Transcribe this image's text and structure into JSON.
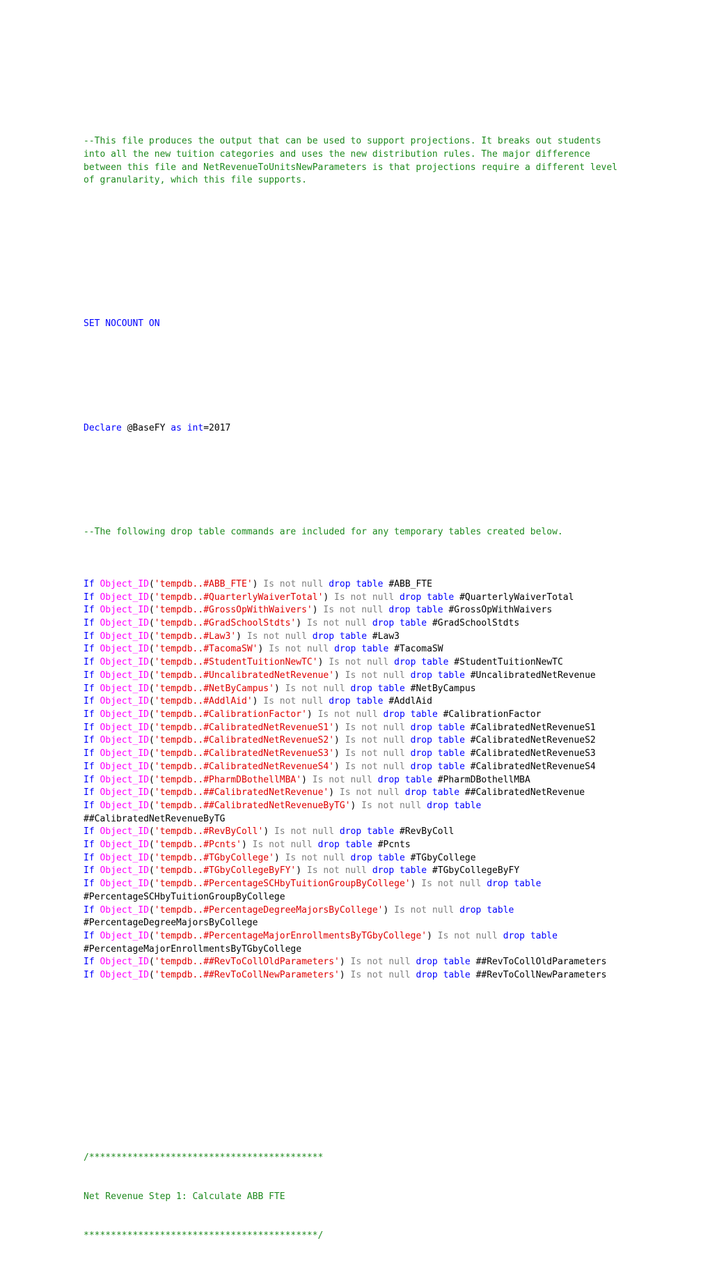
{
  "document": {
    "type": "sql-script-listing",
    "colors": {
      "comment": "#1E8A1E",
      "keyword": "#0000FF",
      "function": "#FF00FF",
      "string": "#E00000",
      "operator_gray": "#808080",
      "plain": "#000000",
      "background": "#FFFFFF"
    }
  },
  "header_comment": {
    "text": "--This file produces the output that can be used to support projections. It breaks out students into all the new tuition categories and uses the new distribution rules. The major difference between this file and NetRevenueToUnitsNewParameters is that projections require a different level of granularity, which this file supports."
  },
  "statements": {
    "set_nocount": "SET NOCOUNT ON",
    "declare_keyword": "Declare",
    "declare_var": " @BaseFY ",
    "declare_as": "as",
    "declare_space": " ",
    "declare_type": "int",
    "declare_assign": "=2017",
    "drop_comment": "--The following drop table commands are included for any temporary tables created below."
  },
  "drop_line_parts": {
    "if": "If ",
    "func": "Object_ID",
    "open_paren": "(",
    "string_prefix": "'tempdb..",
    "string_suffix": "'",
    "close_paren": ")",
    "is_not_null": " Is not null ",
    "drop_table": "drop table",
    "space": " "
  },
  "drop_tables": [
    "#ABB_FTE",
    "#QuarterlyWaiverTotal",
    "#GrossOpWithWaivers",
    "#GradSchoolStdts",
    "#Law3",
    "#TacomaSW",
    "#StudentTuitionNewTC",
    "#UncalibratedNetRevenue",
    "#NetByCampus",
    "#AddlAid",
    "#CalibrationFactor",
    "#CalibratedNetRevenueS1",
    "#CalibratedNetRevenueS2",
    "#CalibratedNetRevenueS3",
    "#CalibratedNetRevenueS4",
    "#PharmDBothellMBA",
    "##CalibratedNetRevenue",
    "##CalibratedNetRevenueByTG",
    "#RevByColl",
    "#Pcnts",
    "#TGbyCollege",
    "#TGbyCollegeByFY",
    "#PercentageSCHbyTuitionGroupByCollege",
    "#PercentageDegreeMajorsByCollege",
    "#PercentageMajorEnrollmentsByTGbyCollege",
    "##RevToCollOldParameters",
    "##RevToCollNewParameters"
  ],
  "section_banner": {
    "top_rule": "/*******************************************",
    "title": "Net Revenue Step 1: Calculate ABB FTE",
    "bottom_rule": "*******************************************/"
  }
}
